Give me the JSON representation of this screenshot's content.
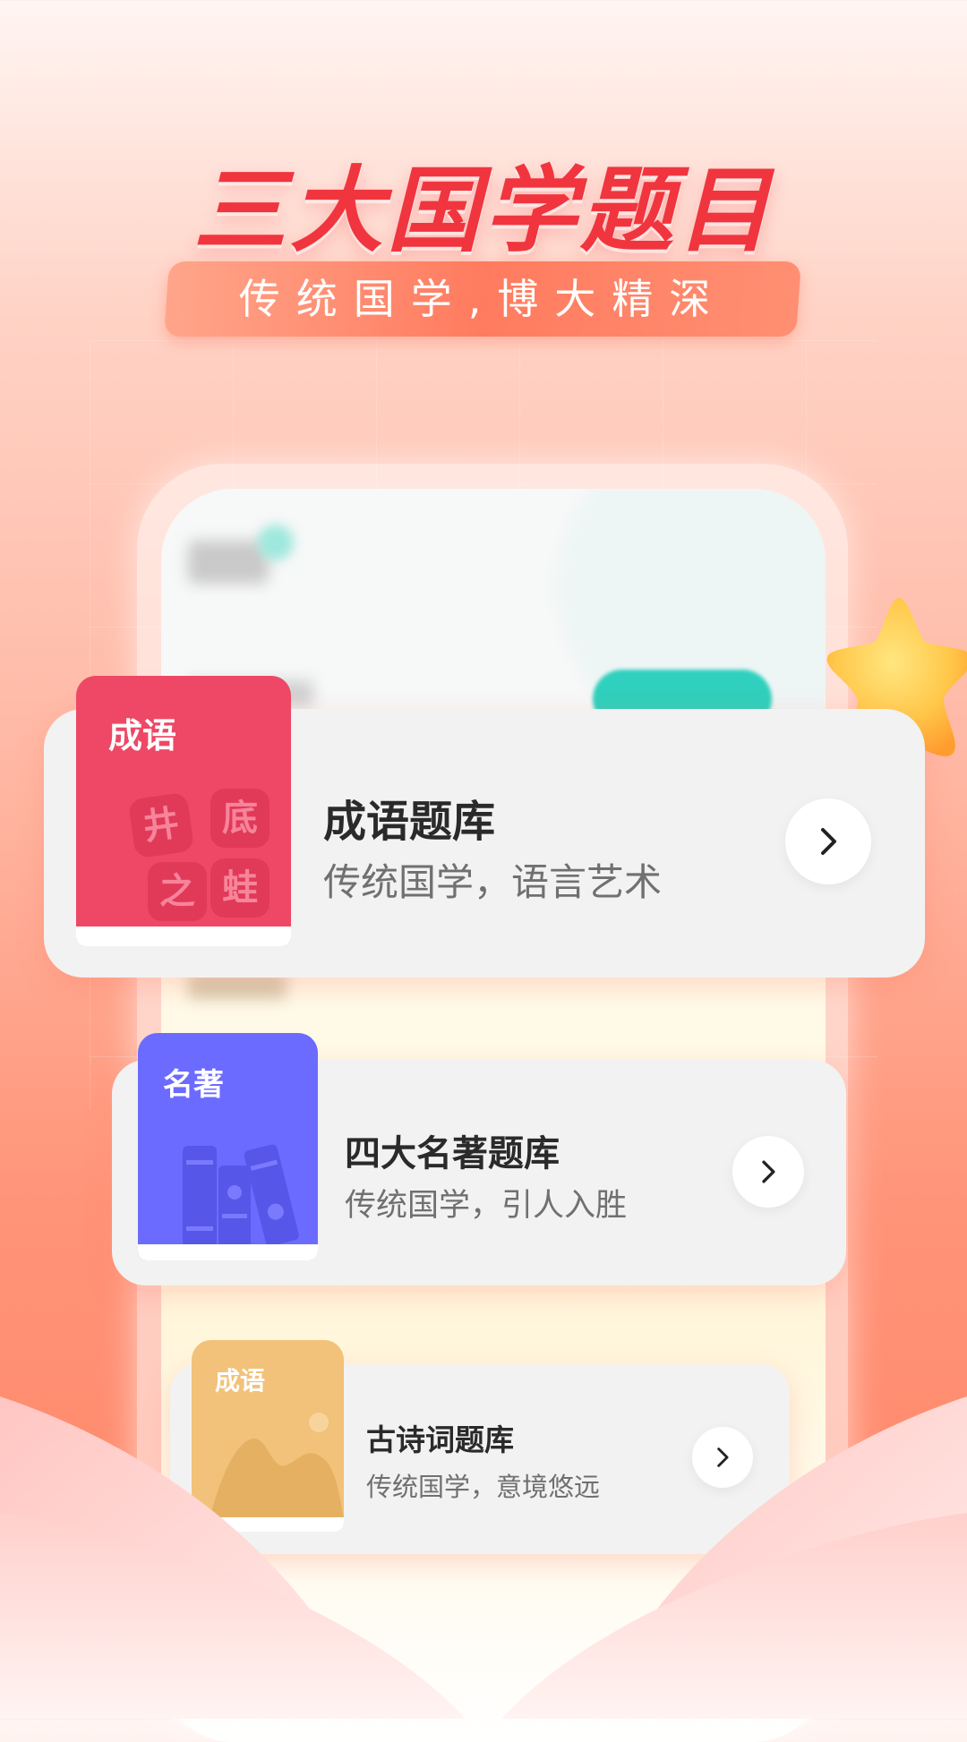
{
  "header": {
    "headline": "三大国学题目",
    "ribbon": "传统国学,博大精深"
  },
  "cards": [
    {
      "cover_tag": "成语",
      "cover_chars": [
        "井",
        "底",
        "之",
        "蛙"
      ],
      "title": "成语题库",
      "subtitle": "传统国学，语言艺术",
      "icon": "chevron-right-icon"
    },
    {
      "cover_tag": "名著",
      "title": "四大名著题库",
      "subtitle": "传统国学，引人入胜",
      "icon": "chevron-right-icon"
    },
    {
      "cover_tag": "成语",
      "title": "古诗词题库",
      "subtitle": "传统国学，意境悠远",
      "icon": "chevron-right-icon"
    }
  ],
  "colors": {
    "headline": "#f0353f",
    "ribbon": "#ff7b5f",
    "idiom_cover": "#ee4866",
    "classics_cover": "#6b6bff",
    "poetry_cover": "#f2c27a",
    "accent_teal": "#2fd0bd"
  },
  "decorations": [
    "star-icon",
    "lotus-petals"
  ]
}
